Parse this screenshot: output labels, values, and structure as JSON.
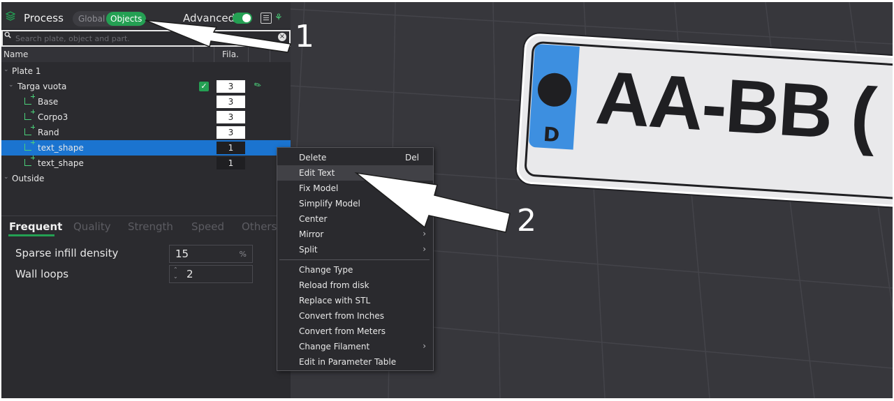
{
  "header": {
    "title": "Process",
    "mode_global": "Global",
    "mode_objects": "Objects",
    "advanced_label": "Advanced"
  },
  "search": {
    "placeholder": "Search plate, object and part."
  },
  "columns": {
    "name": "Name",
    "filament": "Fila."
  },
  "tree": {
    "plate": "Plate 1",
    "object": {
      "label": "Targa vuota",
      "filament": "3"
    },
    "parts": [
      {
        "label": "Base",
        "filament": "3"
      },
      {
        "label": "Corpo3",
        "filament": "3"
      },
      {
        "label": "Rand",
        "filament": "3"
      },
      {
        "label": "text_shape",
        "filament": "1"
      },
      {
        "label": "text_shape",
        "filament": "1"
      }
    ],
    "outside": "Outside"
  },
  "tabs": [
    "Frequent",
    "Quality",
    "Strength",
    "Speed",
    "Others"
  ],
  "params": {
    "sparse_infill": {
      "label": "Sparse infill density",
      "value": "15",
      "unit": "%"
    },
    "wall_loops": {
      "label": "Wall loops",
      "value": "2"
    }
  },
  "context_menu": {
    "items": [
      {
        "label": "Delete",
        "shortcut": "Del"
      },
      {
        "label": "Edit Text"
      },
      {
        "label": "Fix Model"
      },
      {
        "label": "Simplify Model"
      },
      {
        "label": "Center"
      },
      {
        "label": "Mirror"
      },
      {
        "label": "Split"
      },
      {
        "label": "Change Type"
      },
      {
        "label": "Reload from disk"
      },
      {
        "label": "Replace with STL"
      },
      {
        "label": "Convert from Inches"
      },
      {
        "label": "Convert from Meters"
      },
      {
        "label": "Change Filament"
      },
      {
        "label": "Edit in Parameter Table"
      }
    ]
  },
  "plate_model": {
    "country": "D",
    "text": "AA-BB ("
  },
  "annotations": {
    "first": "1",
    "second": "2"
  },
  "colors": {
    "accent": "#24a053",
    "selection": "#1b74d0",
    "plate_blue": "#3d8fe0"
  }
}
